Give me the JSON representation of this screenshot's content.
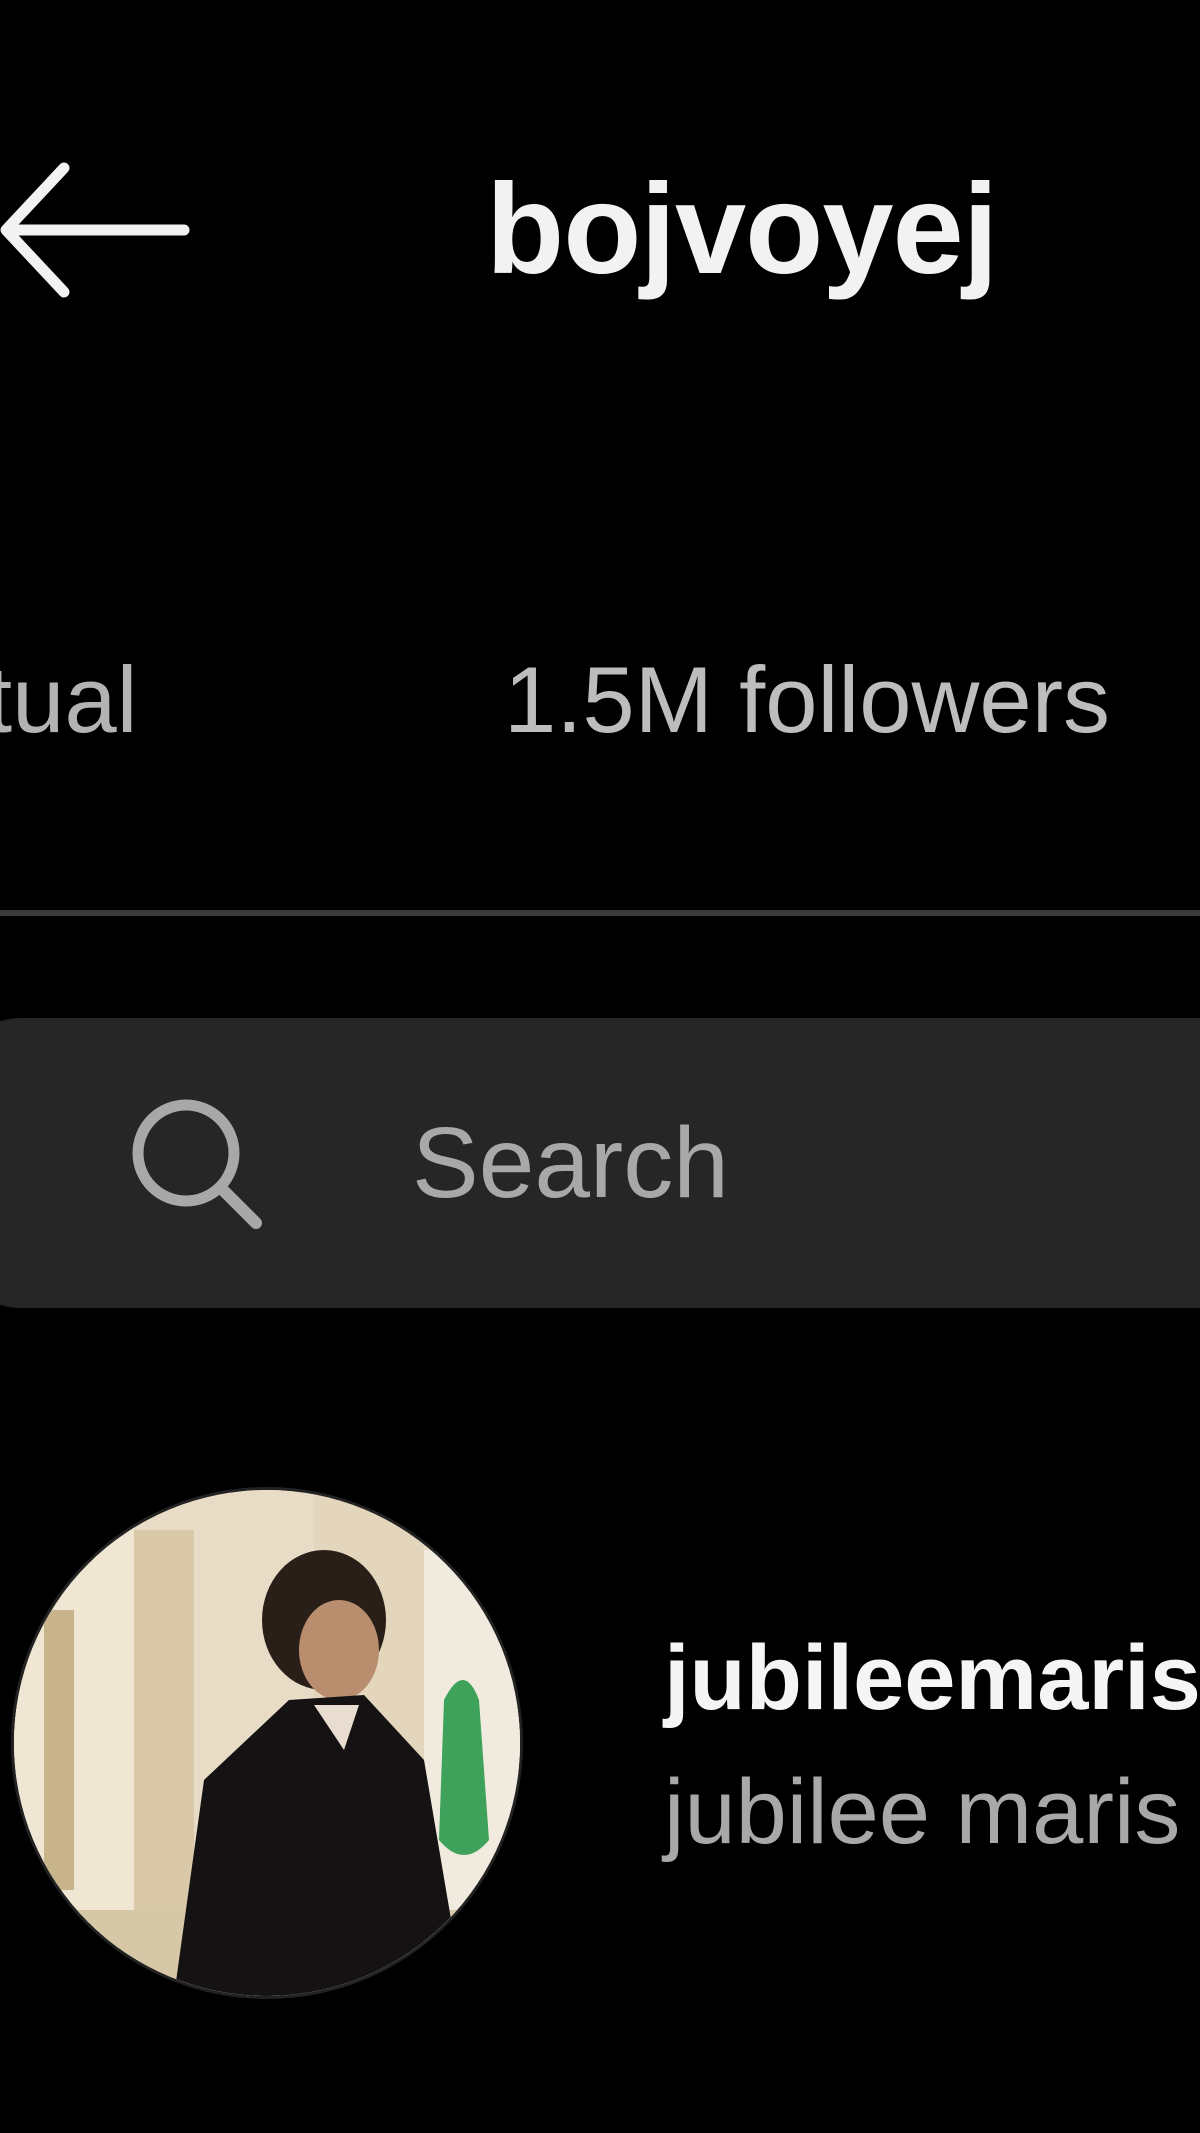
{
  "header": {
    "title": "bojvoyej",
    "back_icon": "arrow-left-icon"
  },
  "tabs": [
    {
      "label": "tual"
    },
    {
      "label": "1.5M followers"
    }
  ],
  "search": {
    "placeholder": "Search",
    "icon": "search-icon"
  },
  "list": {
    "items": [
      {
        "username": "jubileemaris",
        "full_name": "jubilee maris"
      }
    ]
  },
  "colors": {
    "background": "#000000",
    "search_bg": "#262626",
    "secondary_text": "#a8a8a8",
    "divider": "#3a3a3a"
  }
}
